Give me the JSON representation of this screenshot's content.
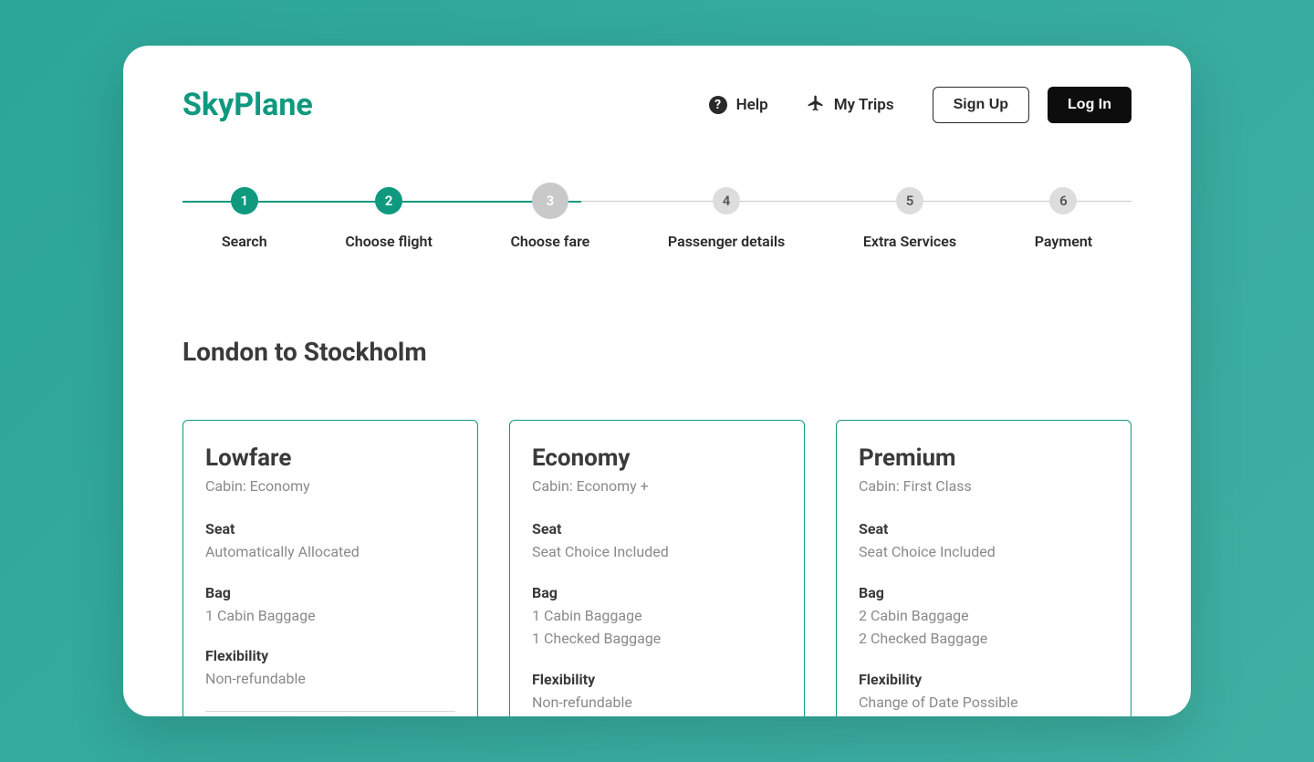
{
  "brand": {
    "name": "SkyPlane"
  },
  "header": {
    "help_label": "Help",
    "trips_label": "My Trips",
    "signup_label": "Sign Up",
    "login_label": "Log In"
  },
  "stepper": {
    "steps": [
      {
        "num": "1",
        "label": "Search",
        "state": "active"
      },
      {
        "num": "2",
        "label": "Choose flight",
        "state": "active"
      },
      {
        "num": "3",
        "label": "Choose fare",
        "state": "current"
      },
      {
        "num": "4",
        "label": "Passenger details",
        "state": "inactive"
      },
      {
        "num": "5",
        "label": "Extra Services",
        "state": "inactive"
      },
      {
        "num": "6",
        "label": "Payment",
        "state": "inactive"
      }
    ]
  },
  "route": {
    "title": "London to Stockholm"
  },
  "fares": [
    {
      "name": "Lowfare",
      "cabin": "Cabin: Economy",
      "seat_title": "Seat",
      "seat_value": "Automatically Allocated",
      "bag_title": "Bag",
      "bag_lines": [
        "1 Cabin Baggage"
      ],
      "flex_title": "Flexibility",
      "flex_value": "Non-refundable"
    },
    {
      "name": "Economy",
      "cabin": "Cabin: Economy +",
      "seat_title": "Seat",
      "seat_value": "Seat Choice Included",
      "bag_title": "Bag",
      "bag_lines": [
        "1 Cabin Baggage",
        "1 Checked Baggage"
      ],
      "flex_title": "Flexibility",
      "flex_value": "Non-refundable"
    },
    {
      "name": "Premium",
      "cabin": "Cabin: First Class",
      "seat_title": "Seat",
      "seat_value": "Seat Choice Included",
      "bag_title": "Bag",
      "bag_lines": [
        "2 Cabin Baggage",
        "2 Checked Baggage"
      ],
      "flex_title": "Flexibility",
      "flex_value": "Change of Date Possible"
    }
  ]
}
